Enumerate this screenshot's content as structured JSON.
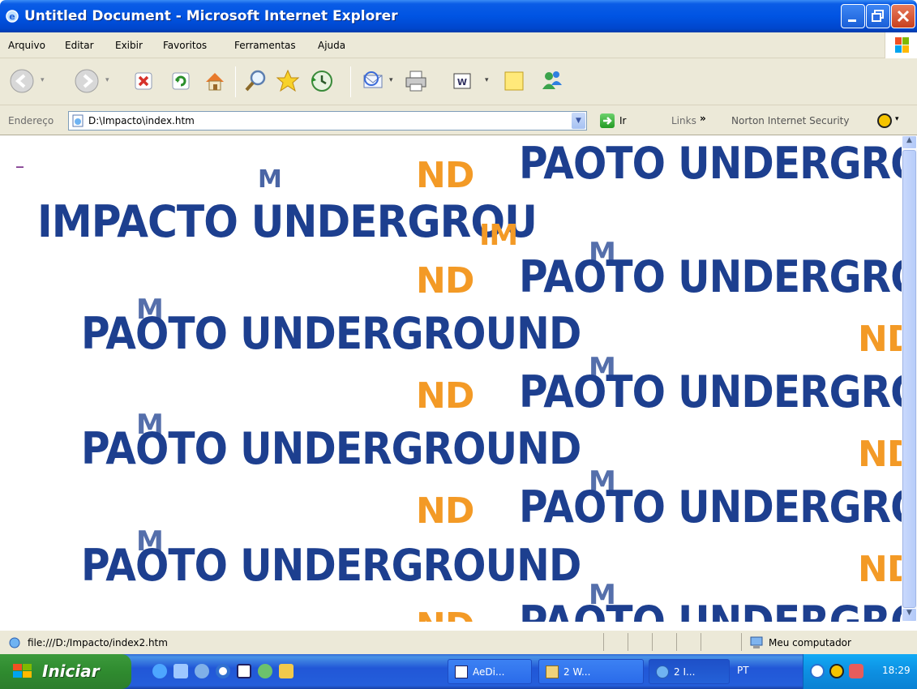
{
  "window": {
    "title": "Untitled Document - Microsoft Internet Explorer"
  },
  "menu": [
    "Arquivo",
    "Editar",
    "Exibir",
    "Favoritos",
    "Ferramentas",
    "Ajuda"
  ],
  "address": {
    "label": "Endereço",
    "value": "D:\\Impacto\\index.htm",
    "go_label": "Ir"
  },
  "links": {
    "label": "Links",
    "overflow": "»",
    "norton": "Norton Internet Security"
  },
  "content": {
    "cursor_mark": "_",
    "heading": "IMPACTO UNDERGROU",
    "fragment_nd": "ND",
    "fragment_im": "IM",
    "fragment_m": "M",
    "repeat_text": "PAOTO UNDERGROUND"
  },
  "status": {
    "url": "file:///D:/Impacto/index2.htm",
    "zone": "Meu computador"
  },
  "taskbar": {
    "start_label": "Iniciar",
    "tasks": [
      "AeDi...",
      "2 W...",
      "2 I..."
    ],
    "language": "PT",
    "clock": "18:29"
  },
  "colors": {
    "text_blue": "#1d3f8f",
    "accent_orange": "#f39a26",
    "xp_blue": "#0054e3"
  }
}
